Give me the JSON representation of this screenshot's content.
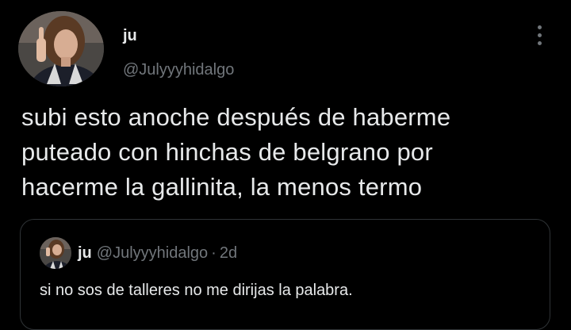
{
  "tweet": {
    "author": {
      "display_name": "ju",
      "handle": "@Julyyyhidalgo"
    },
    "more_icon": "more-vertical-icon",
    "text": "subi esto anoche después de haberme\nputeado con hinchas de belgrano por\nhacerme la gallinita, la menos termo",
    "quoted": {
      "display_name": "ju",
      "handle": "@Julyyyhidalgo",
      "separator": "·",
      "time": "2d",
      "text": "si no sos de talleres no me dirijas la palabra."
    }
  },
  "colors": {
    "background": "#000000",
    "primary_text": "#e7e9ea",
    "secondary_text": "#71767b",
    "border": "#2f3336"
  }
}
